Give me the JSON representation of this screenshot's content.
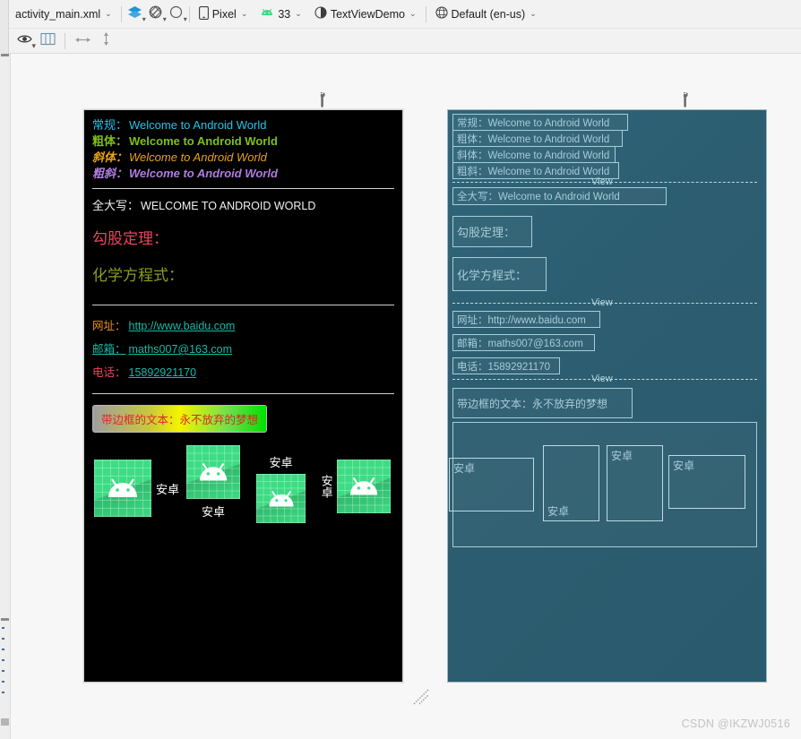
{
  "toolbar": {
    "file_name": "activity_main.xml",
    "icons": [
      {
        "name": "design-surface-icon",
        "label": ""
      },
      {
        "name": "blueprint-icon",
        "label": ""
      },
      {
        "name": "theme-contrast-icon",
        "label": ""
      }
    ],
    "device": "Pixel",
    "api_level": "33",
    "theme": "TextViewDemo",
    "locale": "Default (en-us)",
    "caret": "⌄"
  },
  "toolbar2": {
    "items": [
      {
        "name": "visibility-eye-icon"
      },
      {
        "name": "layout-columns-icon"
      },
      {
        "name": "resize-horizontal-icon"
      },
      {
        "name": "resize-vertical-icon"
      }
    ]
  },
  "design": {
    "styled_rows": [
      {
        "label": "常规：",
        "text": "Welcome to Android World",
        "style": "normal",
        "label_color": "#22c4e6",
        "text_color": "#22c4e6"
      },
      {
        "label": "粗体：",
        "text": "Welcome to Android World",
        "style": "bold",
        "label_color": "#7ec01a",
        "text_color": "#7ec01a"
      },
      {
        "label": "斜体：",
        "text": "Welcome to Android World",
        "style": "italic",
        "label_color": "#e8a317",
        "text_color": "#e8a317"
      },
      {
        "label": "粗斜：",
        "text": "Welcome to Android World",
        "style": "bold-italic",
        "label_color": "#b07de0",
        "text_color": "#b07de0"
      }
    ],
    "uppercase_row": {
      "label": "全大写：",
      "text": "WELCOME TO ANDROID WORLD"
    },
    "formula_rows": [
      {
        "text": "勾股定理：",
        "color": "#e8465c"
      },
      {
        "text": "化学方程式：",
        "color": "#8a9c22"
      }
    ],
    "link_rows": [
      {
        "label": "网址：",
        "value": "http://www.baidu.com",
        "label_color": "#e8901a"
      },
      {
        "label": "邮箱：",
        "value": "maths007@163.com",
        "label_color": "#17b9a8"
      },
      {
        "label": "电话：",
        "value": "15892921170",
        "label_color": "#e8465c"
      }
    ],
    "bordered_text": "带边框的文本：永不放弃的梦想",
    "drawables": [
      {
        "text": "安卓",
        "position": "right"
      },
      {
        "text": "安卓",
        "position": "bottom"
      },
      {
        "text": "安卓",
        "position": "top"
      },
      {
        "text": "安卓",
        "position": "left"
      }
    ]
  },
  "blueprint": {
    "boxes": [
      "常规：Welcome to Android World",
      "粗体：Welcome to Android World",
      "斜体：Welcome to Android World",
      "粗斜：Welcome to Android World",
      "全大写：Welcome to Android World",
      "勾股定理：",
      "化学方程式：",
      "网址：http://www.baidu.com",
      "邮箱：maths007@163.com",
      "电话：15892921170",
      "带边框的文本：永不放弃的梦想"
    ],
    "divider_label": "View",
    "image_labels": [
      "安卓",
      "安卓",
      "安卓",
      "安卓"
    ]
  },
  "watermark": "CSDN @IKZWJ0516"
}
